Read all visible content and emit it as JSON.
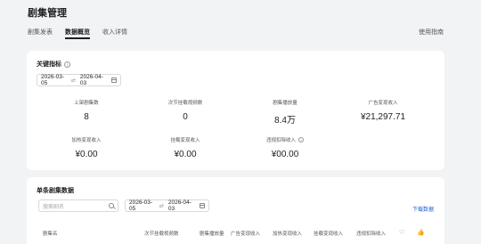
{
  "header": {
    "title": "剧集管理",
    "tabs": [
      {
        "label": "剧集发表",
        "active": false
      },
      {
        "label": "数据概览",
        "active": true
      },
      {
        "label": "收入详情",
        "active": false
      }
    ],
    "help_link": "使用指南"
  },
  "key_metrics": {
    "title": "关键指标",
    "date_start": "2026-03-05",
    "date_end": "2026-04-03",
    "metrics": [
      {
        "label": "上架剧集数",
        "value": "8"
      },
      {
        "label": "次节挂载视频数",
        "value": "0"
      },
      {
        "label": "剧集播放量",
        "value": "8.4万"
      },
      {
        "label": "广告变现收入",
        "value": "¥21,297.71"
      },
      {
        "label": "加热变现收入",
        "value": "¥0.00"
      },
      {
        "label": "挂载变现收入",
        "value": "¥0.00"
      },
      {
        "label": "违规扣除收入",
        "value": "¥00.00"
      }
    ]
  },
  "single_drama": {
    "title": "单条剧集数据",
    "search_placeholder": "搜索剧名",
    "date_start": "2026-03-05",
    "date_end": "2026-04-03",
    "download_label": "下载数据",
    "columns": [
      "剧集名",
      "次节挂载视频数",
      "剧集播放量",
      "广告变现收入",
      "加热变现收入",
      "挂载变现收入",
      "违规扣除收入"
    ]
  },
  "colors": {
    "background": "#f2f3f5",
    "card": "#ffffff",
    "link": "#1f5fd6"
  }
}
